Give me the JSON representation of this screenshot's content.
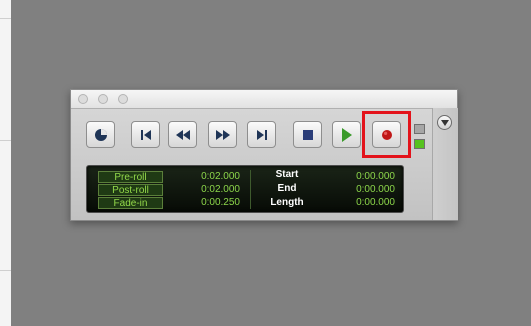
{
  "window": {
    "traffic_lights": [
      "close",
      "minimize",
      "zoom"
    ]
  },
  "transport": {
    "buttons": [
      {
        "name": "online-button",
        "icon": "online-icon"
      },
      {
        "name": "return-to-zero-button",
        "icon": "skip-back-icon"
      },
      {
        "name": "rewind-button",
        "icon": "rewind-icon"
      },
      {
        "name": "fast-forward-button",
        "icon": "fast-forward-icon"
      },
      {
        "name": "go-to-end-button",
        "icon": "skip-forward-icon"
      },
      {
        "name": "stop-button",
        "icon": "stop-icon"
      },
      {
        "name": "play-button",
        "icon": "play-icon"
      },
      {
        "name": "record-button",
        "icon": "record-icon"
      }
    ],
    "record_highlight_color": "#e3131b",
    "play_color": "#3a9a2a",
    "stop_color": "#2a3d78",
    "record_color": "#c01818"
  },
  "counter": {
    "rows": [
      {
        "label": "Pre-roll",
        "value": "0:02.000",
        "field": "Start",
        "field_value": "0:00.000"
      },
      {
        "label": "Post-roll",
        "value": "0:02.000",
        "field": "End",
        "field_value": "0:00.000"
      },
      {
        "label": "Fade-in",
        "value": "0:00.250",
        "field": "Length",
        "field_value": "0:00.000"
      }
    ]
  },
  "indicators": {
    "top_color": "#a6a6a6",
    "bottom_color": "#56c21f"
  }
}
